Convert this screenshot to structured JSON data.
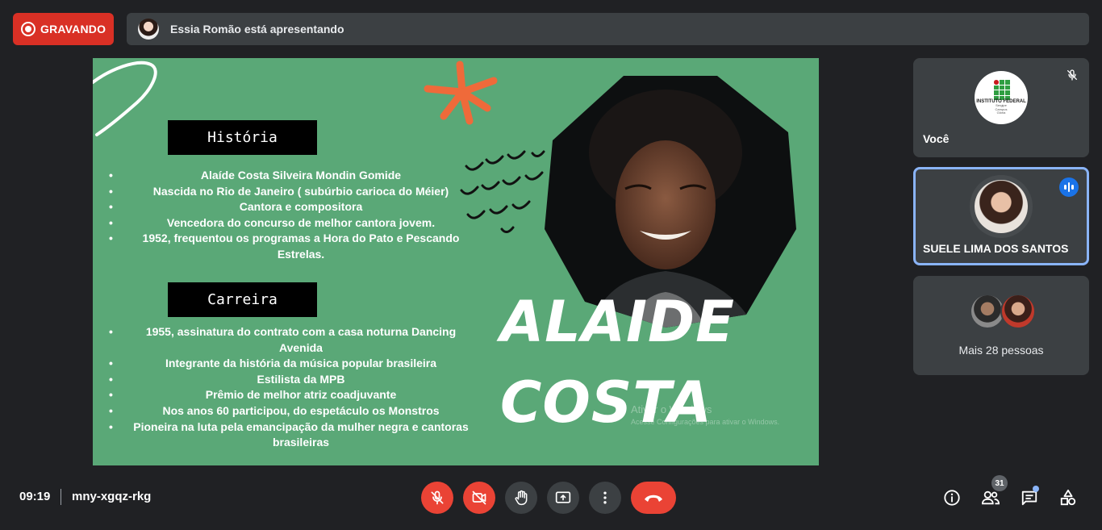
{
  "recording": {
    "label": "GRAVANDO"
  },
  "presenter": {
    "text": "Essia Romão está apresentando"
  },
  "slide": {
    "section1": {
      "title": "História",
      "bullets": [
        "Alaíde Costa Silveira Mondin Gomide",
        "Nascida no Rio de Janeiro ( subúrbio carioca do Méier)",
        "Cantora e compositora",
        "Vencedora do concurso de melhor cantora jovem.",
        "1952, frequentou os programas a Hora do Pato e Pescando Estrelas."
      ]
    },
    "section2": {
      "title": "Carreira",
      "bullets": [
        "1955, assinatura do contrato com a casa noturna Dancing Avenida",
        "Integrante da história da música popular brasileira",
        "Estilista da MPB",
        "Prêmio de melhor atriz coadjuvante",
        "Nos anos 60 participou, do espetáculo os Monstros",
        "Pioneira na luta pela emancipação da mulher negra e cantoras brasileiras"
      ]
    },
    "name_line1": "ALAIDE",
    "name_line2": "COSTA",
    "watermark_line1": "Ativar o Windows",
    "watermark_line2": "Acesse Configurações para ativar o Windows.",
    "colors": {
      "background": "#5aa877",
      "star": "#ef6a3a",
      "box": "#000000"
    }
  },
  "participants": {
    "self": {
      "name": "Você",
      "logo_text": "INSTITUTO FEDERAL",
      "logo_sub1": "Sergipe",
      "logo_sub2": "Campus",
      "logo_sub3": "Glória",
      "mic": "mic-off-icon"
    },
    "speaker": {
      "name": "SUELE LIMA DOS SANTOS",
      "status": "speaking-icon"
    },
    "others": {
      "label": "Mais 28 pessoas"
    }
  },
  "bottom_bar": {
    "time": "09:19",
    "meeting_code": "mny-xgqz-rkg",
    "participant_count": "31",
    "controls": [
      "mic-off-icon",
      "camera-off-icon",
      "raise-hand-icon",
      "present-icon",
      "more-icon",
      "end-call-icon"
    ],
    "right_icons": [
      "info-icon",
      "people-icon",
      "chat-icon",
      "activities-icon"
    ]
  }
}
